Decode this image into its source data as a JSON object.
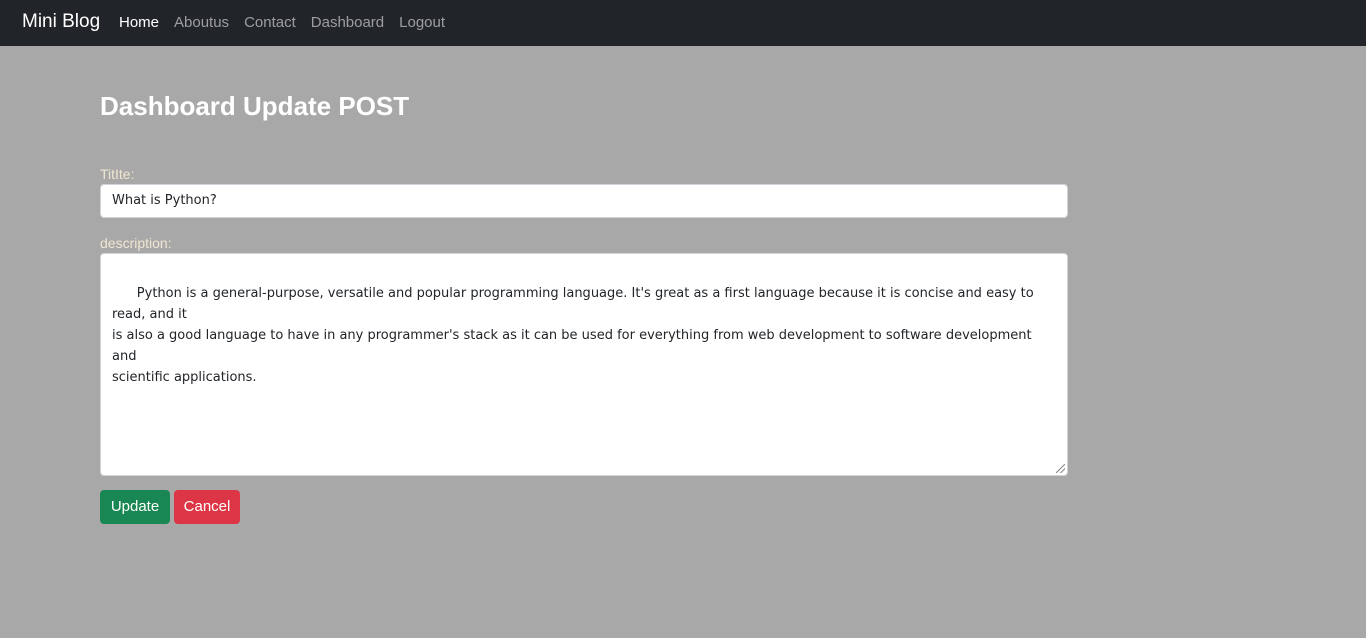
{
  "navbar": {
    "brand": "Mini Blog",
    "links": [
      {
        "label": "Home",
        "active": true
      },
      {
        "label": "Aboutus",
        "active": false
      },
      {
        "label": "Contact",
        "active": false
      },
      {
        "label": "Dashboard",
        "active": false
      },
      {
        "label": "Logout",
        "active": false
      }
    ]
  },
  "page": {
    "title": "Dashboard Update POST"
  },
  "form": {
    "title_label": "TitIte:",
    "title_value": "What is Python?",
    "description_label": "description:",
    "description_value": "Python is a general-purpose, versatile and popular programming language. It's great as a first language because it is concise and easy to read, and it\nis also a good language to have in any programmer's stack as it can be used for everything from web development to software development and\nscientific applications.",
    "update_label": "Update",
    "cancel_label": "Cancel"
  },
  "colors": {
    "navbar_bg": "#212529",
    "page_bg": "#a8a8a8",
    "update_button": "#198754",
    "cancel_button": "#dc3545"
  }
}
